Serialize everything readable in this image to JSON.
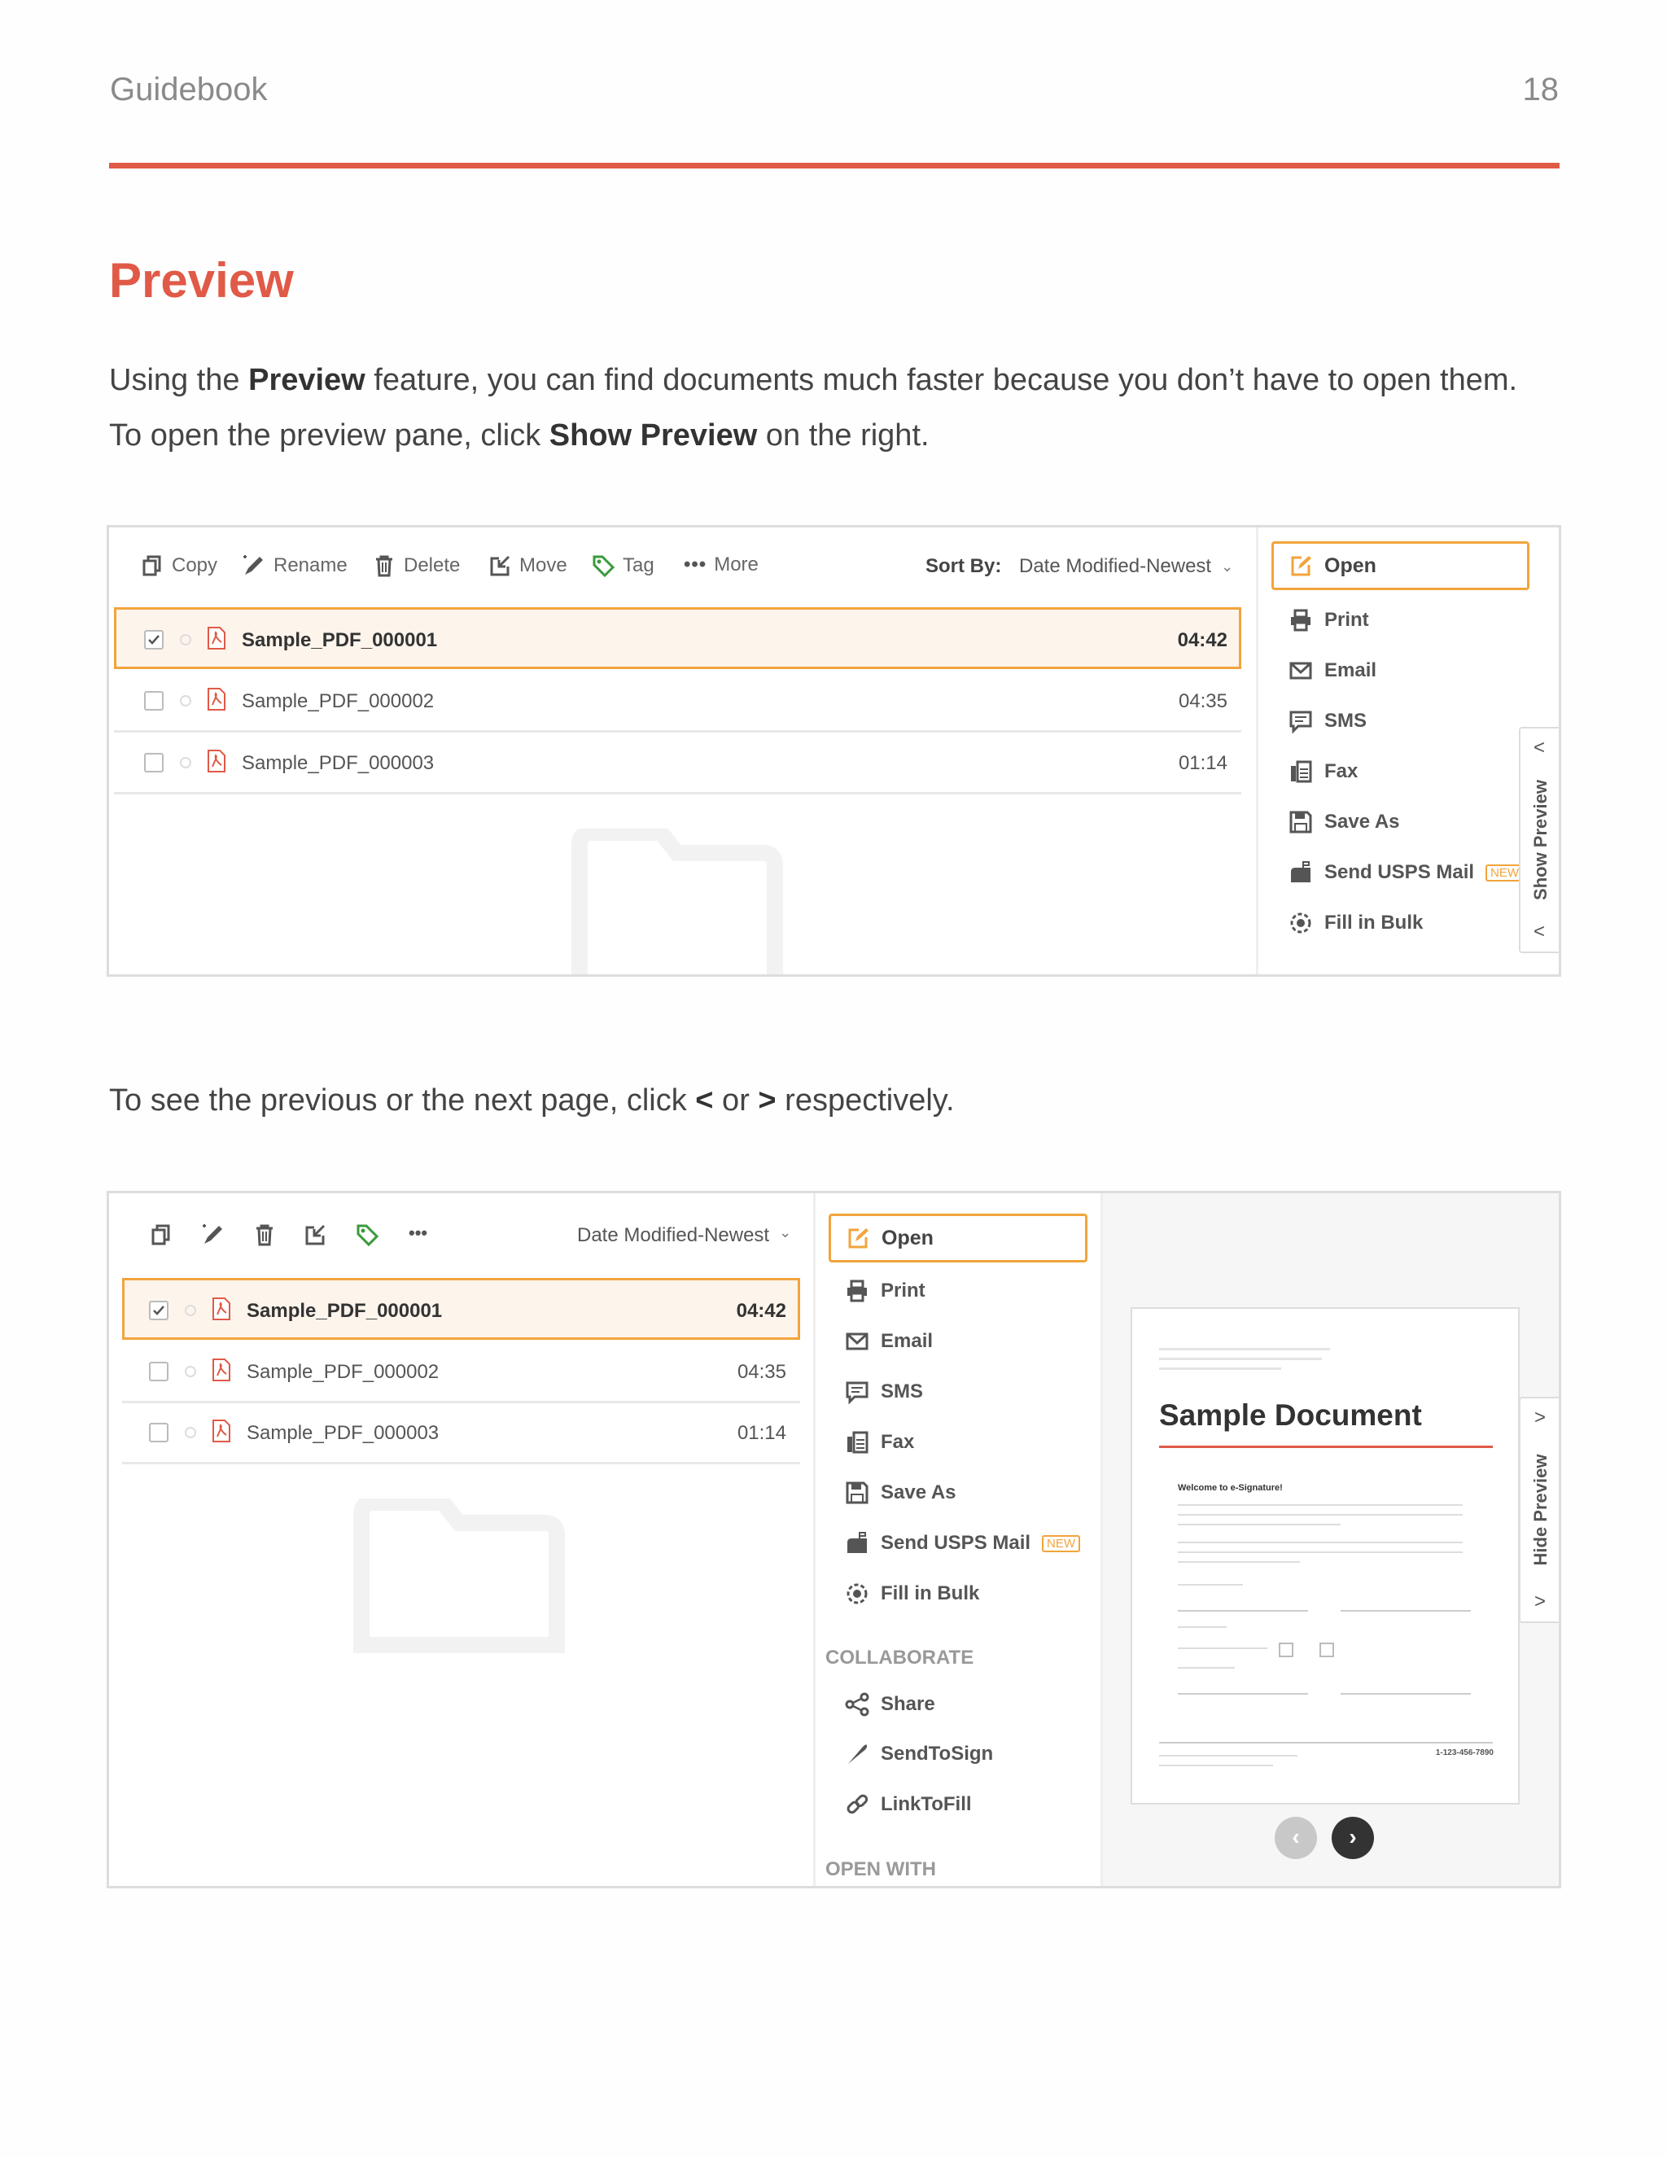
{
  "header": {
    "left": "Guidebook",
    "page_number": "18"
  },
  "title": "Preview",
  "para1": {
    "line1_pre": "Using the ",
    "line1_bold": "Preview",
    "line1_post": " feature, you can find documents much faster because you don’t have to open them.",
    "line2_pre": "To open the preview pane, click ",
    "line2_bold": "Show Preview",
    "line2_post": " on the right."
  },
  "para2": {
    "pre": "To see the previous or the next page, click ",
    "lt": "<",
    "mid": " or ",
    "gt": ">",
    "post": " respectively."
  },
  "shot1": {
    "toolbar": [
      "Copy",
      "Rename",
      "Delete",
      "Move",
      "Tag",
      "More"
    ],
    "sort_label": "Sort By:",
    "sort_value": "Date Modified-Newest",
    "files": [
      {
        "name": "Sample_PDF_000001",
        "time": "04:42",
        "selected": true
      },
      {
        "name": "Sample_PDF_000002",
        "time": "04:35",
        "selected": false
      },
      {
        "name": "Sample_PDF_000003",
        "time": "01:14",
        "selected": false
      }
    ],
    "menu": {
      "open": "Open",
      "items": [
        "Print",
        "Email",
        "SMS",
        "Fax",
        "Save As",
        "Send USPS Mail",
        "Fill in Bulk"
      ],
      "new_badge": "NEW"
    },
    "side_tab": "Show Preview"
  },
  "shot2": {
    "sort_value": "Date Modified-Newest",
    "files": [
      {
        "name": "Sample_PDF_000001",
        "time": "04:42",
        "selected": true
      },
      {
        "name": "Sample_PDF_000002",
        "time": "04:35",
        "selected": false
      },
      {
        "name": "Sample_PDF_000003",
        "time": "01:14",
        "selected": false
      }
    ],
    "menu": {
      "open": "Open",
      "items": [
        "Print",
        "Email",
        "SMS",
        "Fax",
        "Save As",
        "Send USPS Mail",
        "Fill in Bulk"
      ],
      "new_badge": "NEW",
      "collaborate_heading": "COLLABORATE",
      "collab_items": [
        "Share",
        "SendToSign",
        "LinkToFill"
      ],
      "open_with_heading": "OPEN WITH"
    },
    "preview": {
      "doc_title": "Sample Document",
      "welcome": "Welcome to e-Signature!",
      "phone": "1-123-456-7890"
    },
    "side_tab": "Hide Preview"
  },
  "colors": {
    "accent": "#e05a47",
    "highlight": "#f2a43c"
  }
}
